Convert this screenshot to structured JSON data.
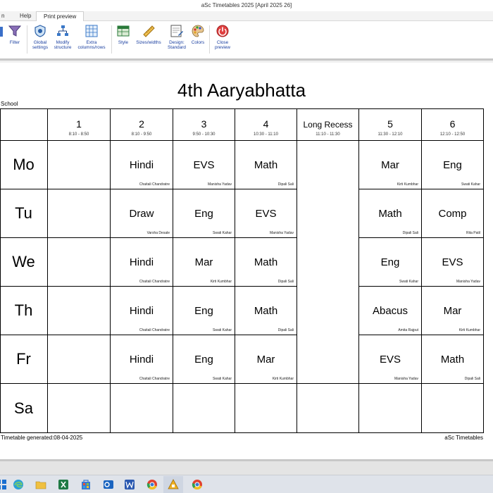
{
  "window": {
    "title": "aSc Timetables 2025     [April 2025 26]"
  },
  "menu": {
    "tabs": [
      {
        "label": "n"
      },
      {
        "label": "Help"
      },
      {
        "label": "Print preview"
      }
    ]
  },
  "ribbon": {
    "buttons": [
      {
        "label": "Filter",
        "icon": "filter-icon"
      },
      {
        "label": "Global settings",
        "icon": "settings-icon"
      },
      {
        "label": "Modify structure",
        "icon": "structure-icon"
      },
      {
        "label": "Extra columns/rows",
        "icon": "grid-icon"
      },
      {
        "label": "Style",
        "icon": "style-icon"
      },
      {
        "label": "Sizes/widths",
        "icon": "ruler-icon"
      },
      {
        "label": "Design: Standard",
        "icon": "design-icon"
      },
      {
        "label": "Colors",
        "icon": "palette-icon"
      },
      {
        "label": "Close preview",
        "icon": "close-icon"
      }
    ]
  },
  "document": {
    "title": "4th Aaryabhatta",
    "school_label": "School",
    "footer_left": "Timetable generated:08-04-2025",
    "footer_right": "aSc Timetables"
  },
  "timetable": {
    "periods": [
      {
        "label": "1",
        "time": "8:10 - 8:50"
      },
      {
        "label": "2",
        "time": "8:10 - 9:50"
      },
      {
        "label": "3",
        "time": "9:50 - 10:30"
      },
      {
        "label": "4",
        "time": "10:30 - 11:10"
      },
      {
        "label": "Long Recess",
        "time": "11:10 - 11:30"
      },
      {
        "label": "5",
        "time": "11:30 - 12:10"
      },
      {
        "label": "6",
        "time": "12:10 - 12:50"
      }
    ],
    "days": [
      {
        "label": "Mo",
        "lessons": [
          null,
          {
            "subject": "Hindi",
            "teacher": "Chaitali Chandratre"
          },
          {
            "subject": "EVS",
            "teacher": "Manisha Yadav"
          },
          {
            "subject": "Math",
            "teacher": "Dipali Sali"
          },
          null,
          {
            "subject": "Mar",
            "teacher": "Kirti Kumbhar"
          },
          {
            "subject": "Eng",
            "teacher": "Swati Kahar"
          }
        ]
      },
      {
        "label": "Tu",
        "lessons": [
          null,
          {
            "subject": "Draw",
            "teacher": "Varsha Desale"
          },
          {
            "subject": "Eng",
            "teacher": "Swati Kahar"
          },
          {
            "subject": "EVS",
            "teacher": "Manisha Yadav"
          },
          null,
          {
            "subject": "Math",
            "teacher": "Dipali Sali"
          },
          {
            "subject": "Comp",
            "teacher": "Rita Patil"
          }
        ]
      },
      {
        "label": "We",
        "lessons": [
          null,
          {
            "subject": "Hindi",
            "teacher": "Chaitali Chandratre"
          },
          {
            "subject": "Mar",
            "teacher": "Kirti Kumbhar"
          },
          {
            "subject": "Math",
            "teacher": "Dipali Sali"
          },
          null,
          {
            "subject": "Eng",
            "teacher": "Swati Kahar"
          },
          {
            "subject": "EVS",
            "teacher": "Manisha Yadav"
          }
        ]
      },
      {
        "label": "Th",
        "lessons": [
          null,
          {
            "subject": "Hindi",
            "teacher": "Chaitali Chandratre"
          },
          {
            "subject": "Eng",
            "teacher": "Swati Kahar"
          },
          {
            "subject": "Math",
            "teacher": "Dipali Sali"
          },
          null,
          {
            "subject": "Abacus",
            "teacher": "Amita Rajput"
          },
          {
            "subject": "Mar",
            "teacher": "Kirti Kumbhar"
          }
        ]
      },
      {
        "label": "Fr",
        "lessons": [
          null,
          {
            "subject": "Hindi",
            "teacher": "Chaitali Chandratre"
          },
          {
            "subject": "Eng",
            "teacher": "Swati Kahar"
          },
          {
            "subject": "Mar",
            "teacher": "Kirti Kumbhar"
          },
          null,
          {
            "subject": "EVS",
            "teacher": "Manisha Yadav"
          },
          {
            "subject": "Math",
            "teacher": "Dipali Sali"
          }
        ]
      },
      {
        "label": "Sa",
        "lessons": [
          null,
          null,
          null,
          null,
          null,
          null,
          null
        ]
      }
    ]
  },
  "taskbar": {
    "icons": [
      "windows-icon",
      "edge-icon",
      "file-explorer-icon",
      "excel-icon",
      "store-icon",
      "outlook-icon",
      "word-icon",
      "chrome-icon",
      "asc-timetables-icon",
      "chrome-alt-icon"
    ]
  }
}
